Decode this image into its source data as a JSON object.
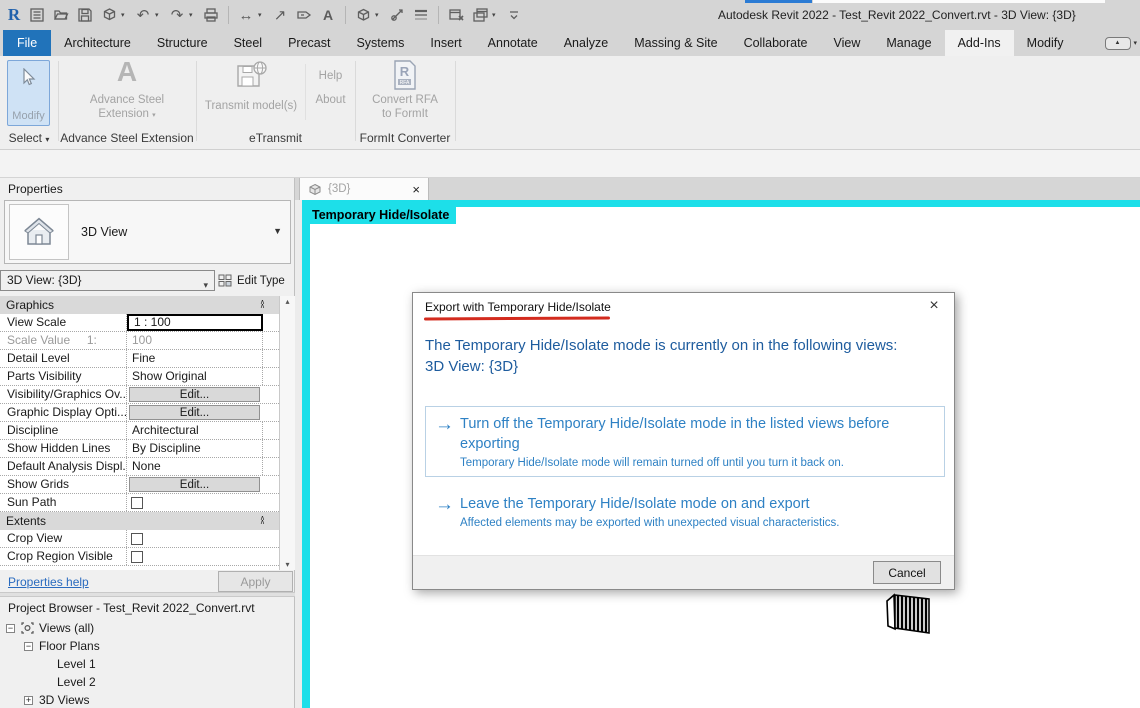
{
  "titlebar": {
    "title": "Autodesk Revit 2022 - Test_Revit 2022_Convert.rvt - 3D View: {3D}"
  },
  "qat": {
    "icons": [
      "revit-logo",
      "properties-palette",
      "open",
      "save",
      "synchronize",
      "undo",
      "redo",
      "print",
      "measure",
      "aligned-dimension",
      "tag-by-category",
      "text",
      "default-3d-view",
      "section",
      "thin-lines",
      "close-inactive-windows",
      "switch-windows",
      "customize-quick-access-toolbar"
    ]
  },
  "ribbon": {
    "tabs": [
      "File",
      "Architecture",
      "Structure",
      "Steel",
      "Precast",
      "Systems",
      "Insert",
      "Annotate",
      "Analyze",
      "Massing & Site",
      "Collaborate",
      "View",
      "Manage",
      "Add-Ins",
      "Modify"
    ],
    "active_tab": "Add-Ins",
    "file_tab": "File",
    "panels": {
      "select": {
        "button_label": "Modify",
        "panel_label": "Select"
      },
      "advance_steel": {
        "button_line1": "Advance Steel",
        "button_line2": "Extension",
        "panel_label": "Advance Steel Extension"
      },
      "etransmit": {
        "button_label": "Transmit model(s)",
        "help_label": "Help",
        "about_label": "About",
        "panel_label": "eTransmit"
      },
      "formit": {
        "button_line1": "Convert RFA",
        "button_line2": "to FormIt",
        "panel_label": "FormIt Converter"
      }
    }
  },
  "properties": {
    "title": "Properties",
    "type_name": "3D View",
    "instance_name": "3D View: {3D}",
    "edit_type_label": "Edit Type",
    "groups": [
      {
        "header": "Graphics",
        "rows": [
          {
            "label": "View Scale",
            "value": "1 : 100",
            "kind": "input"
          },
          {
            "label": "Scale Value     1:",
            "value": "100",
            "kind": "dim"
          },
          {
            "label": "Detail Level",
            "value": "Fine",
            "kind": "text"
          },
          {
            "label": "Parts Visibility",
            "value": "Show Original",
            "kind": "text"
          },
          {
            "label": "Visibility/Graphics Ov...",
            "value": "Edit...",
            "kind": "button"
          },
          {
            "label": "Graphic Display Opti...",
            "value": "Edit...",
            "kind": "button"
          },
          {
            "label": "Discipline",
            "value": "Architectural",
            "kind": "text"
          },
          {
            "label": "Show Hidden Lines",
            "value": "By Discipline",
            "kind": "text"
          },
          {
            "label": "Default Analysis Displ...",
            "value": "None",
            "kind": "text"
          },
          {
            "label": "Show Grids",
            "value": "Edit...",
            "kind": "button"
          },
          {
            "label": "Sun Path",
            "value": "",
            "kind": "checkbox"
          }
        ]
      },
      {
        "header": "Extents",
        "rows": [
          {
            "label": "Crop View",
            "value": "",
            "kind": "checkbox"
          },
          {
            "label": "Crop Region Visible",
            "value": "",
            "kind": "checkbox"
          }
        ]
      }
    ],
    "help_link": "Properties help",
    "apply_label": "Apply"
  },
  "project_browser": {
    "title": "Project Browser - Test_Revit 2022_Convert.rvt",
    "tree": [
      {
        "label": "Views (all)",
        "level": 0,
        "expander": "minus",
        "icon": "views"
      },
      {
        "label": "Floor Plans",
        "level": 1,
        "expander": "minus"
      },
      {
        "label": "Level 1",
        "level": 2,
        "expander": "none"
      },
      {
        "label": "Level 2",
        "level": 2,
        "expander": "none"
      },
      {
        "label": "3D Views",
        "level": 1,
        "expander": "plus"
      }
    ]
  },
  "viewport": {
    "tab_label": "{3D}",
    "banner_text": "Temporary Hide/Isolate"
  },
  "dialog": {
    "title": "Export with Temporary Hide/Isolate",
    "message_line1": "The Temporary Hide/Isolate mode is currently on in the following views:",
    "message_line2": "3D View: {3D}",
    "options": [
      {
        "title": "Turn off the Temporary Hide/Isolate mode in the listed views before exporting",
        "subtitle": "Temporary Hide/Isolate mode will remain turned off until you turn it back on.",
        "boxed": true
      },
      {
        "title": "Leave the Temporary Hide/Isolate mode on and export",
        "subtitle": "Affected elements may be exported with unexpected visual characteristics.",
        "boxed": false
      }
    ],
    "cancel_label": "Cancel"
  },
  "theme": {
    "accent_cyan": "#1ddfe9",
    "file_tab_blue": "#2173ba",
    "dialog_text_blue": "#1e5c9e",
    "dialog_link_blue": "#2e81c4",
    "underline_red": "#d32b1e",
    "modify_highlight": "#cfe2f5"
  }
}
